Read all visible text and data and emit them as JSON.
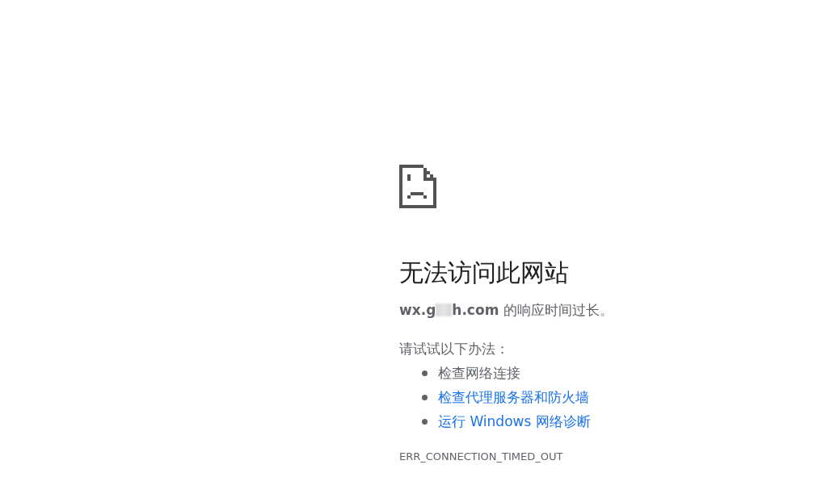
{
  "error_page": {
    "title": "无法访问此网站",
    "message": {
      "host_start": "wx.g",
      "host_end": "h.com",
      "text": "的响应时间过长。"
    },
    "suggestions_heading": "请试试以下办法：",
    "suggestions": [
      {
        "text": "检查网络连接",
        "kind": "plain"
      },
      {
        "text": "检查代理服务器和防火墙",
        "kind": "link"
      },
      {
        "text": "运行 Windows 网络诊断",
        "kind": "link"
      }
    ],
    "error_code": "ERR_CONNECTION_TIMED_OUT"
  }
}
